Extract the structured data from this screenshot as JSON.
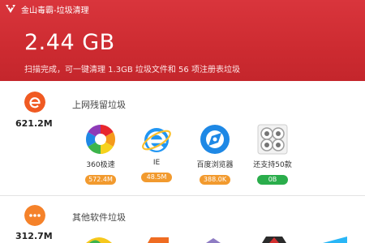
{
  "window": {
    "title": "金山毒霸-垃圾清理"
  },
  "summary": {
    "total_size": "2.44 GB",
    "description": "扫描完成，可一键清理 1.3GB 垃圾文件和 56 项注册表垃圾"
  },
  "categories": [
    {
      "title": "上网残留垃圾",
      "size": "621.2M",
      "icon": "ie-e-icon",
      "apps": [
        {
          "name": "360极速",
          "size": "572.4M",
          "icon": "360-browser-icon",
          "badge_color": "#f29a2e"
        },
        {
          "name": "IE",
          "size": "48.5M",
          "icon": "ie-icon",
          "badge_color": "#f29a2e"
        },
        {
          "name": "百度浏览器",
          "size": "388.0K",
          "icon": "baidu-browser-icon",
          "badge_color": "#f29a2e"
        },
        {
          "name": "还支持50款",
          "size": "0B",
          "icon": "more-apps-icon",
          "badge_color": "#2aad4b"
        }
      ]
    },
    {
      "title": "其他软件垃圾",
      "size": "312.7M",
      "icon": "more-dots-icon",
      "apps": []
    }
  ],
  "colors": {
    "header_red": "#cd2b31",
    "badge_orange": "#f29a2e",
    "badge_green": "#2aad4b",
    "category_orange": "#f05a22"
  }
}
